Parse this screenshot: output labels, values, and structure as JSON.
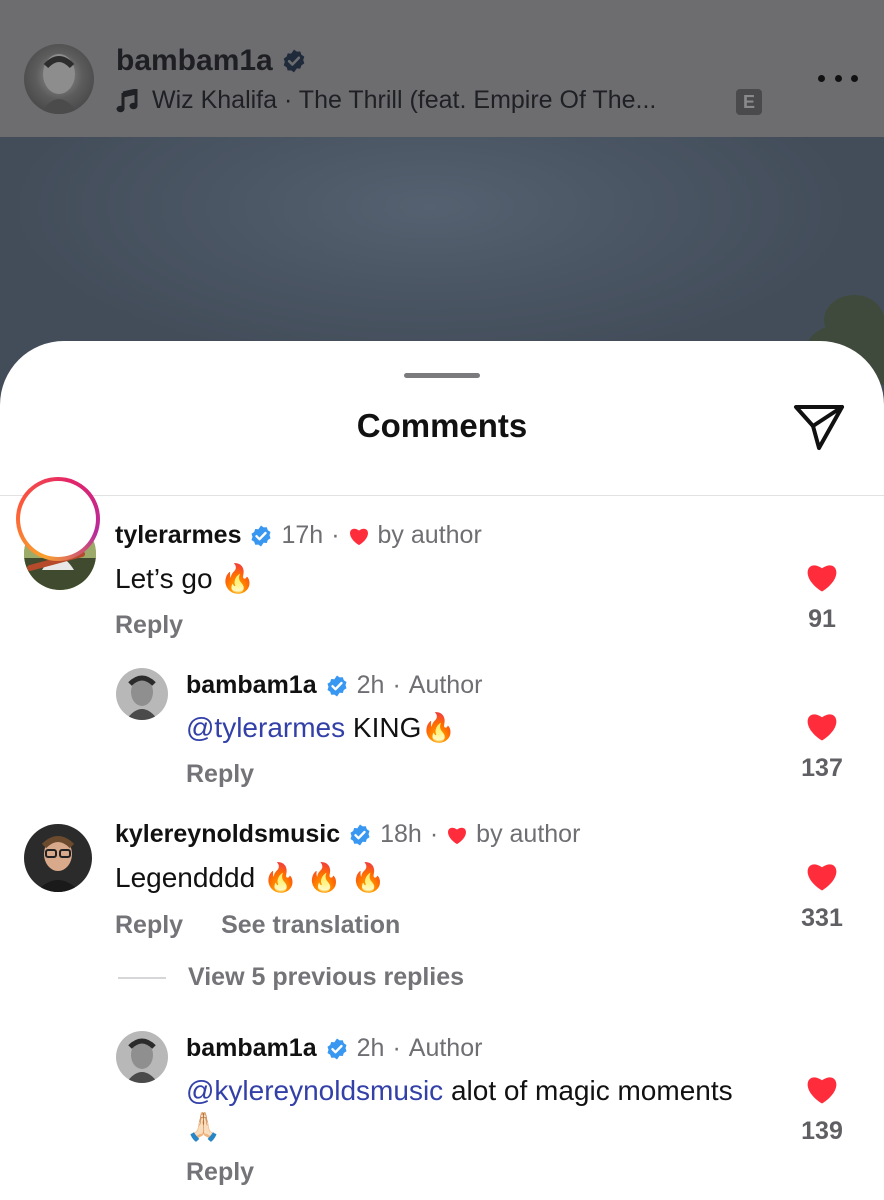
{
  "post": {
    "username": "bambam1a",
    "music": "Wiz Khalifa · The Thrill (feat. Empire Of The...",
    "explicit_badge": "E"
  },
  "comments_sheet": {
    "title": "Comments",
    "comments": [
      {
        "username": "tylerarmes",
        "time": "17h",
        "liked_by": "by author",
        "text": "Let’s go ",
        "emoji": "🔥",
        "reply": "Reply",
        "likes": "91"
      },
      {
        "username": "bambam1a",
        "time": "2h",
        "role": "Author",
        "mention": "@tylerarmes",
        "text": " KING",
        "emoji": "🔥",
        "reply": "Reply",
        "likes": "137"
      },
      {
        "username": "kylereynoldsmusic",
        "time": "18h",
        "liked_by": "by author",
        "text": "Legendddd ",
        "emoji": "🔥 🔥 🔥",
        "reply": "Reply",
        "see_translation": "See translation",
        "likes": "331"
      },
      {
        "username": "bambam1a",
        "time": "2h",
        "role": "Author",
        "mention": "@kylereynoldsmusic",
        "text": " alot of magic moments",
        "emoji": "🙏🏻",
        "reply": "Reply",
        "likes": "139"
      }
    ],
    "view_previous_replies": "View 5 previous replies"
  },
  "colors": {
    "like_red": "#ff2d3c",
    "verified_blue": "#3897f0",
    "mention_blue": "#3240a8"
  }
}
